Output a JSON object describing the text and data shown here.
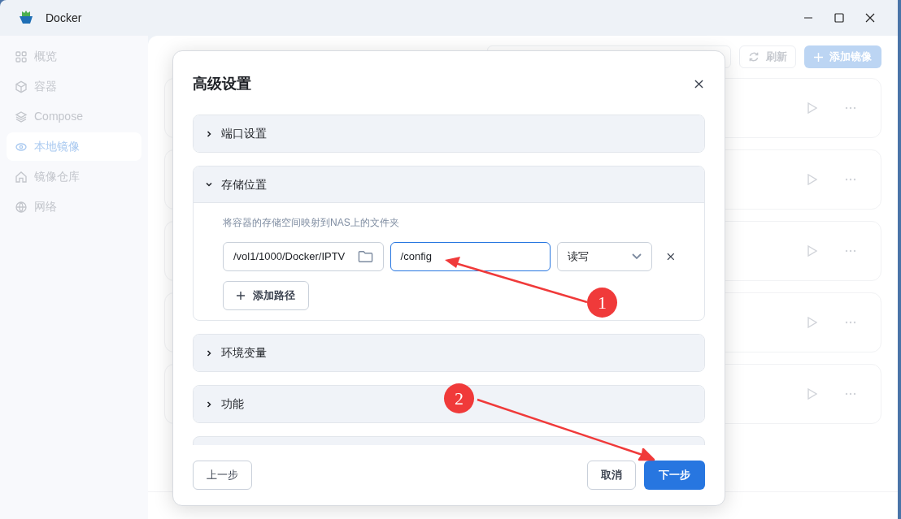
{
  "window": {
    "title": "Docker"
  },
  "sidebar": {
    "items": [
      {
        "label": "概览",
        "selected": false
      },
      {
        "label": "容器",
        "selected": false
      },
      {
        "label": "Compose",
        "selected": false
      },
      {
        "label": "本地镜像",
        "selected": true
      },
      {
        "label": "镜像仓库",
        "selected": false
      },
      {
        "label": "网络",
        "selected": false
      }
    ]
  },
  "main": {
    "refresh_button": "刷新",
    "add_button": "添加镜像"
  },
  "dialog": {
    "title": "高级设置",
    "sections": [
      {
        "title": "端口设置",
        "expanded": false
      },
      {
        "title": "存储位置",
        "expanded": true,
        "description": "将容器的存储空间映射到NAS上的文件夹",
        "mounts": [
          {
            "host_path": "/vol1/1000/Docker/IPTV",
            "container_path": "/config",
            "focused": true,
            "mode": "读写"
          }
        ],
        "add_label": "添加路径"
      },
      {
        "title": "环境变量",
        "expanded": false
      },
      {
        "title": "功能",
        "expanded": false
      }
    ],
    "back_button": "上一步",
    "cancel_button": "取消",
    "next_button": "下一步"
  },
  "annotations": [
    {
      "label": "1"
    },
    {
      "label": "2"
    }
  ]
}
